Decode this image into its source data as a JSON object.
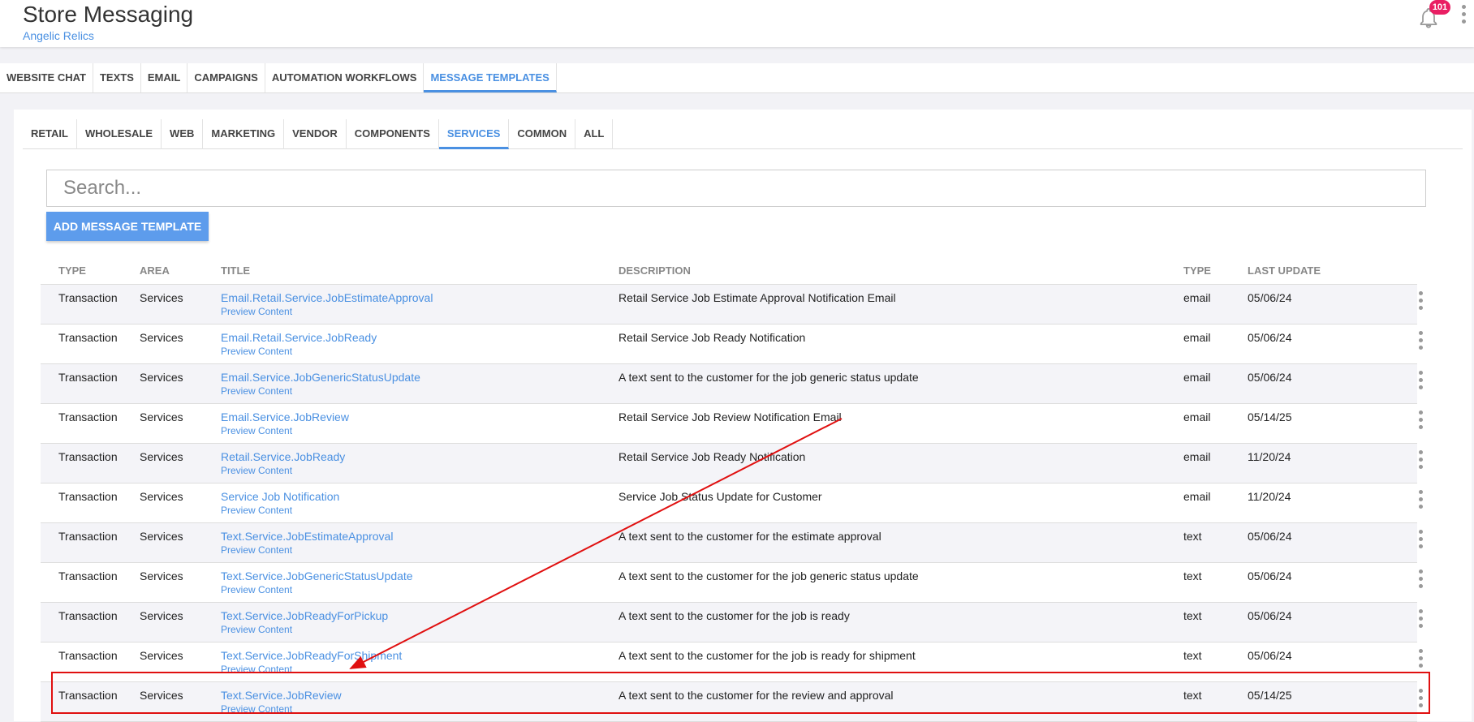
{
  "header": {
    "title": "Store Messaging",
    "subtitle": "Angelic Relics",
    "notification_count": "101"
  },
  "main_tabs": [
    {
      "label": "WEBSITE CHAT"
    },
    {
      "label": "TEXTS"
    },
    {
      "label": "EMAIL"
    },
    {
      "label": "CAMPAIGNS"
    },
    {
      "label": "AUTOMATION WORKFLOWS"
    },
    {
      "label": "MESSAGE TEMPLATES",
      "active": true
    }
  ],
  "sub_tabs": [
    {
      "label": "RETAIL"
    },
    {
      "label": "WHOLESALE"
    },
    {
      "label": "WEB"
    },
    {
      "label": "MARKETING"
    },
    {
      "label": "VENDOR"
    },
    {
      "label": "COMPONENTS"
    },
    {
      "label": "SERVICES",
      "active": true
    },
    {
      "label": "COMMON"
    },
    {
      "label": "ALL"
    }
  ],
  "search": {
    "placeholder": "Search..."
  },
  "add_button_label": "ADD MESSAGE TEMPLATE",
  "table": {
    "headers": {
      "type": "TYPE",
      "area": "AREA",
      "title": "TITLE",
      "description": "DESCRIPTION",
      "type2": "TYPE",
      "last_update": "LAST UPDATE"
    },
    "preview_label": "Preview Content",
    "rows": [
      {
        "type": "Transaction",
        "area": "Services",
        "title": "Email.Retail.Service.JobEstimateApproval",
        "description": "Retail Service Job Estimate Approval Notification Email",
        "channel": "email",
        "last_update": "05/06/24"
      },
      {
        "type": "Transaction",
        "area": "Services",
        "title": "Email.Retail.Service.JobReady",
        "description": "Retail Service Job Ready Notification",
        "channel": "email",
        "last_update": "05/06/24"
      },
      {
        "type": "Transaction",
        "area": "Services",
        "title": "Email.Service.JobGenericStatusUpdate",
        "description": "A text sent to the customer for the job generic status update",
        "channel": "email",
        "last_update": "05/06/24"
      },
      {
        "type": "Transaction",
        "area": "Services",
        "title": "Email.Service.JobReview",
        "description": "Retail Service Job Review Notification Email",
        "channel": "email",
        "last_update": "05/14/25"
      },
      {
        "type": "Transaction",
        "area": "Services",
        "title": "Retail.Service.JobReady",
        "description": "Retail Service Job Ready Notification",
        "channel": "email",
        "last_update": "11/20/24"
      },
      {
        "type": "Transaction",
        "area": "Services",
        "title": "Service Job Notification",
        "description": "Service Job Status Update for Customer",
        "channel": "email",
        "last_update": "11/20/24"
      },
      {
        "type": "Transaction",
        "area": "Services",
        "title": "Text.Service.JobEstimateApproval",
        "description": "A text sent to the customer for the estimate approval",
        "channel": "text",
        "last_update": "05/06/24"
      },
      {
        "type": "Transaction",
        "area": "Services",
        "title": "Text.Service.JobGenericStatusUpdate",
        "description": "A text sent to the customer for the job generic status update",
        "channel": "text",
        "last_update": "05/06/24"
      },
      {
        "type": "Transaction",
        "area": "Services",
        "title": "Text.Service.JobReadyForPickup",
        "description": "A text sent to the customer for the job is ready",
        "channel": "text",
        "last_update": "05/06/24"
      },
      {
        "type": "Transaction",
        "area": "Services",
        "title": "Text.Service.JobReadyForShipment",
        "description": "A text sent to the customer for the job is ready for shipment",
        "channel": "text",
        "last_update": "05/06/24"
      },
      {
        "type": "Transaction",
        "area": "Services",
        "title": "Text.Service.JobReview",
        "description": "A text sent to the customer for the review and approval",
        "channel": "text",
        "last_update": "05/14/25"
      }
    ]
  },
  "colors": {
    "accent": "#4a90e2",
    "button": "#5d9cec",
    "badge": "#e91e63",
    "annotation": "#e01010"
  }
}
